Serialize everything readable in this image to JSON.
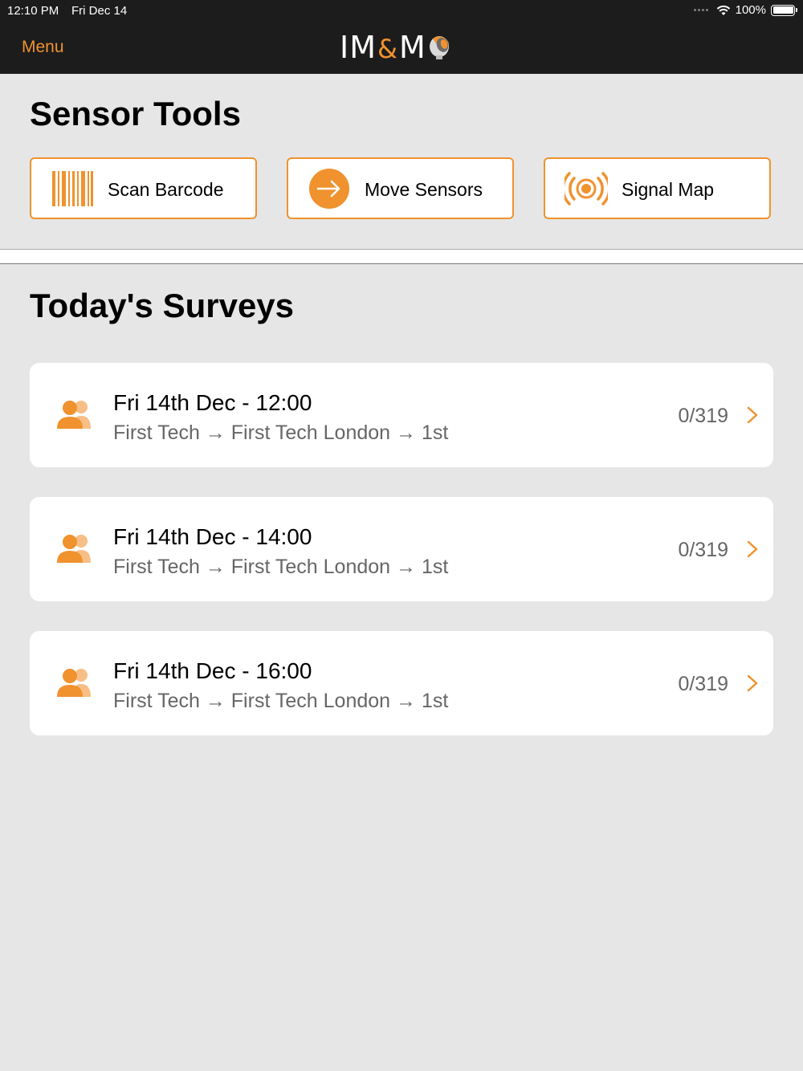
{
  "status_bar": {
    "time": "12:10 PM",
    "date": "Fri Dec 14",
    "battery": "100%"
  },
  "nav": {
    "menu_label": "Menu",
    "logo": "IM&M"
  },
  "sensor_tools": {
    "title": "Sensor Tools",
    "buttons": [
      {
        "label": "Scan Barcode",
        "icon": "barcode-icon"
      },
      {
        "label": "Move Sensors",
        "icon": "arrow-right-circle-icon"
      },
      {
        "label": "Signal Map",
        "icon": "signal-icon"
      }
    ]
  },
  "surveys": {
    "title": "Today's Surveys",
    "items": [
      {
        "title": "Fri 14th Dec - 12:00",
        "subtitle": "First Tech → First Tech London → 1st",
        "count": "0/319"
      },
      {
        "title": "Fri 14th Dec - 14:00",
        "subtitle": "First Tech → First Tech London → 1st",
        "count": "0/319"
      },
      {
        "title": "Fri 14th Dec - 16:00",
        "subtitle": "First Tech → First Tech London → 1st",
        "count": "0/319"
      }
    ]
  },
  "colors": {
    "accent": "#f0922e",
    "navbar": "#1c1c1c",
    "background": "#e6e6e6"
  }
}
